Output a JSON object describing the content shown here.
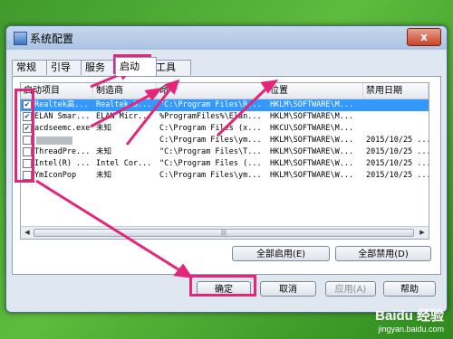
{
  "window": {
    "title": "系统配置",
    "close_label": "x"
  },
  "tabs": [
    "常规",
    "引导",
    "服务",
    "启动",
    "工具"
  ],
  "active_tab": "启动",
  "columns": [
    "启动项目",
    "制造商",
    "命令",
    "位置",
    "禁用日期"
  ],
  "rows": [
    {
      "checked": true,
      "item": "Realtek高...",
      "maker": "Realtek S...",
      "command": "\"C:\\Program Files\\R...",
      "location": "HKLM\\SOFTWARE\\M...",
      "date": ""
    },
    {
      "checked": true,
      "item": "ELAN Smar...",
      "maker": "ELAN Micr...",
      "command": "%ProgramFiles%\\Elan...",
      "location": "HKLM\\SOFTWARE\\M...",
      "date": ""
    },
    {
      "checked": true,
      "item": "acdseemc.exe",
      "maker": "未知",
      "command": "C:\\Program Files (x...",
      "location": "HKCU\\SOFTWARE\\M...",
      "date": ""
    },
    {
      "checked": false,
      "item": "",
      "maker": "",
      "command": "C:\\Program Files\\ym...",
      "location": "HKLM\\SOFTWARE\\W...",
      "date": "2015/10/25 ..."
    },
    {
      "checked": false,
      "item": "ThreadPre...",
      "maker": "未知",
      "command": "\"C:\\Program Files\\T...",
      "location": "HKLM\\SOFTWARE\\W...",
      "date": "2015/10/25 ..."
    },
    {
      "checked": false,
      "item": "Intel(R) ...",
      "maker": "Intel Cor...",
      "command": "\"C:\\Program Files (...",
      "location": "HKLM\\SOFTWARE\\W...",
      "date": "2015/10/25 ..."
    },
    {
      "checked": false,
      "item": "YmIconPop",
      "maker": "未知",
      "command": "C:\\Program Files\\ym...",
      "location": "HKLM\\SOFTWARE\\W...",
      "date": "2015/10/25 ..."
    }
  ],
  "buttons": {
    "enable_all": "全部启用(E)",
    "disable_all": "全部禁用(D)",
    "ok": "确定",
    "cancel": "取消",
    "apply": "应用(A)",
    "help": "帮助"
  },
  "watermark": {
    "logo": "Baidu 经验",
    "url": "jingyan.baidu.com"
  },
  "colors": {
    "highlight": "#e3267b",
    "selection": "#3399ff"
  }
}
